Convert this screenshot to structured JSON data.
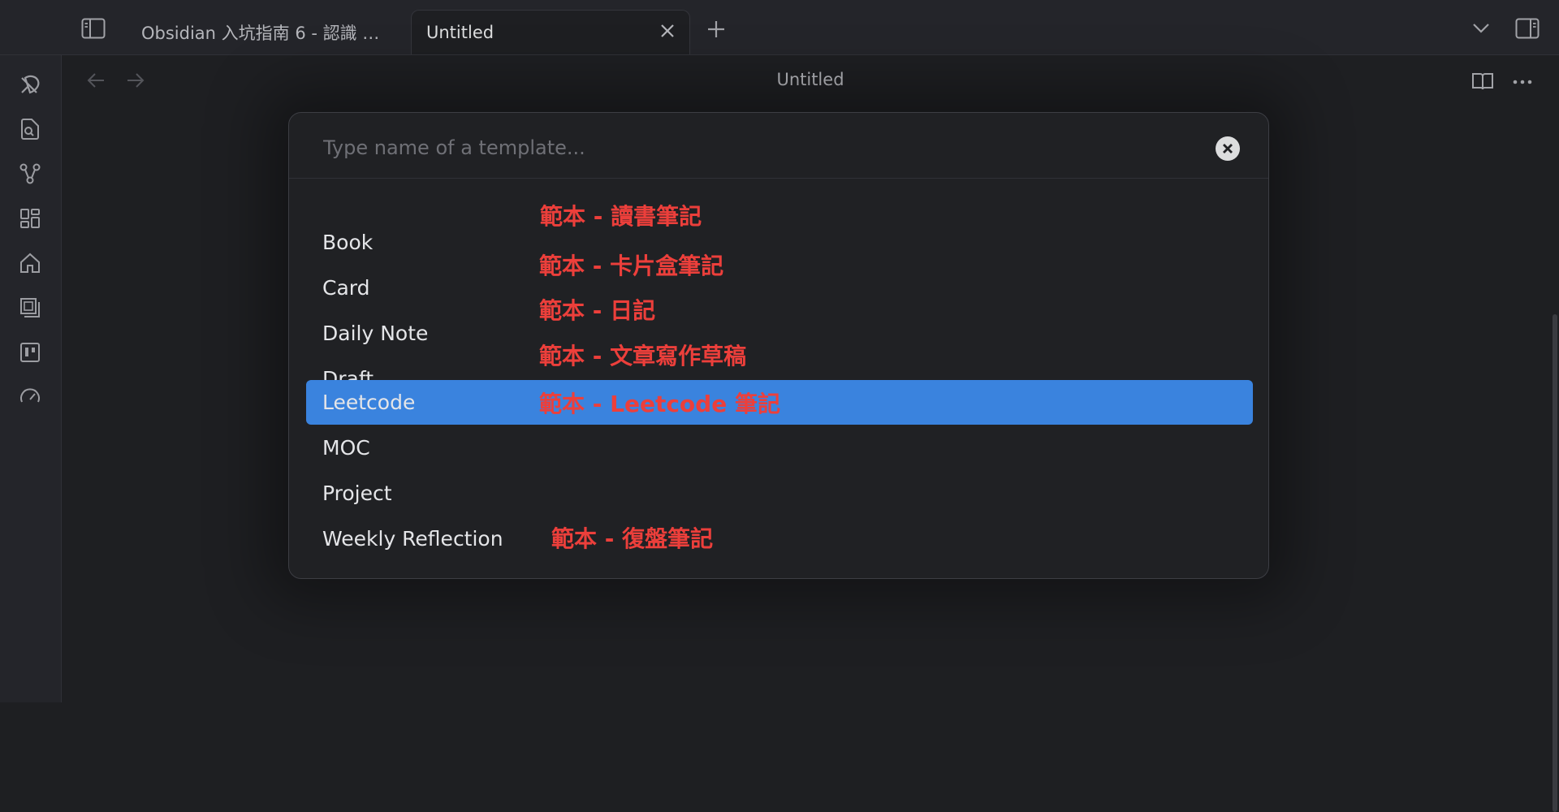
{
  "tabs": [
    {
      "title": "Obsidian 入坑指南 6 - 認識 …",
      "active": false
    },
    {
      "title": "Untitled",
      "active": true
    }
  ],
  "view": {
    "title": "Untitled"
  },
  "ribbon": {
    "icons": [
      "quick-switcher-icon",
      "search-file-icon",
      "graph-view-icon",
      "plugins-grid-icon",
      "home-icon",
      "canvas-stack-icon",
      "kanban-icon",
      "speed-gauge-icon"
    ]
  },
  "modal": {
    "placeholder": "Type name of a template...",
    "suggestions": [
      {
        "name": "Book",
        "annotation": "範本 - 讀書筆記"
      },
      {
        "name": "Card",
        "annotation": "範本 - 卡片盒筆記"
      },
      {
        "name": "Daily Note",
        "annotation": "範本 - 日記"
      },
      {
        "name": "Draft",
        "annotation": "範本 - 文章寫作草稿"
      },
      {
        "name": "Leetcode",
        "annotation": "範本 - Leetcode 筆記",
        "selected": true
      },
      {
        "name": "MOC",
        "annotation": ""
      },
      {
        "name": "Project",
        "annotation": ""
      },
      {
        "name": "Weekly Reflection",
        "annotation": "範本 - 復盤筆記"
      }
    ]
  },
  "colors": {
    "accent": "#3a83de",
    "annotation": "#ec3f3b",
    "background": "#1e1f22"
  }
}
